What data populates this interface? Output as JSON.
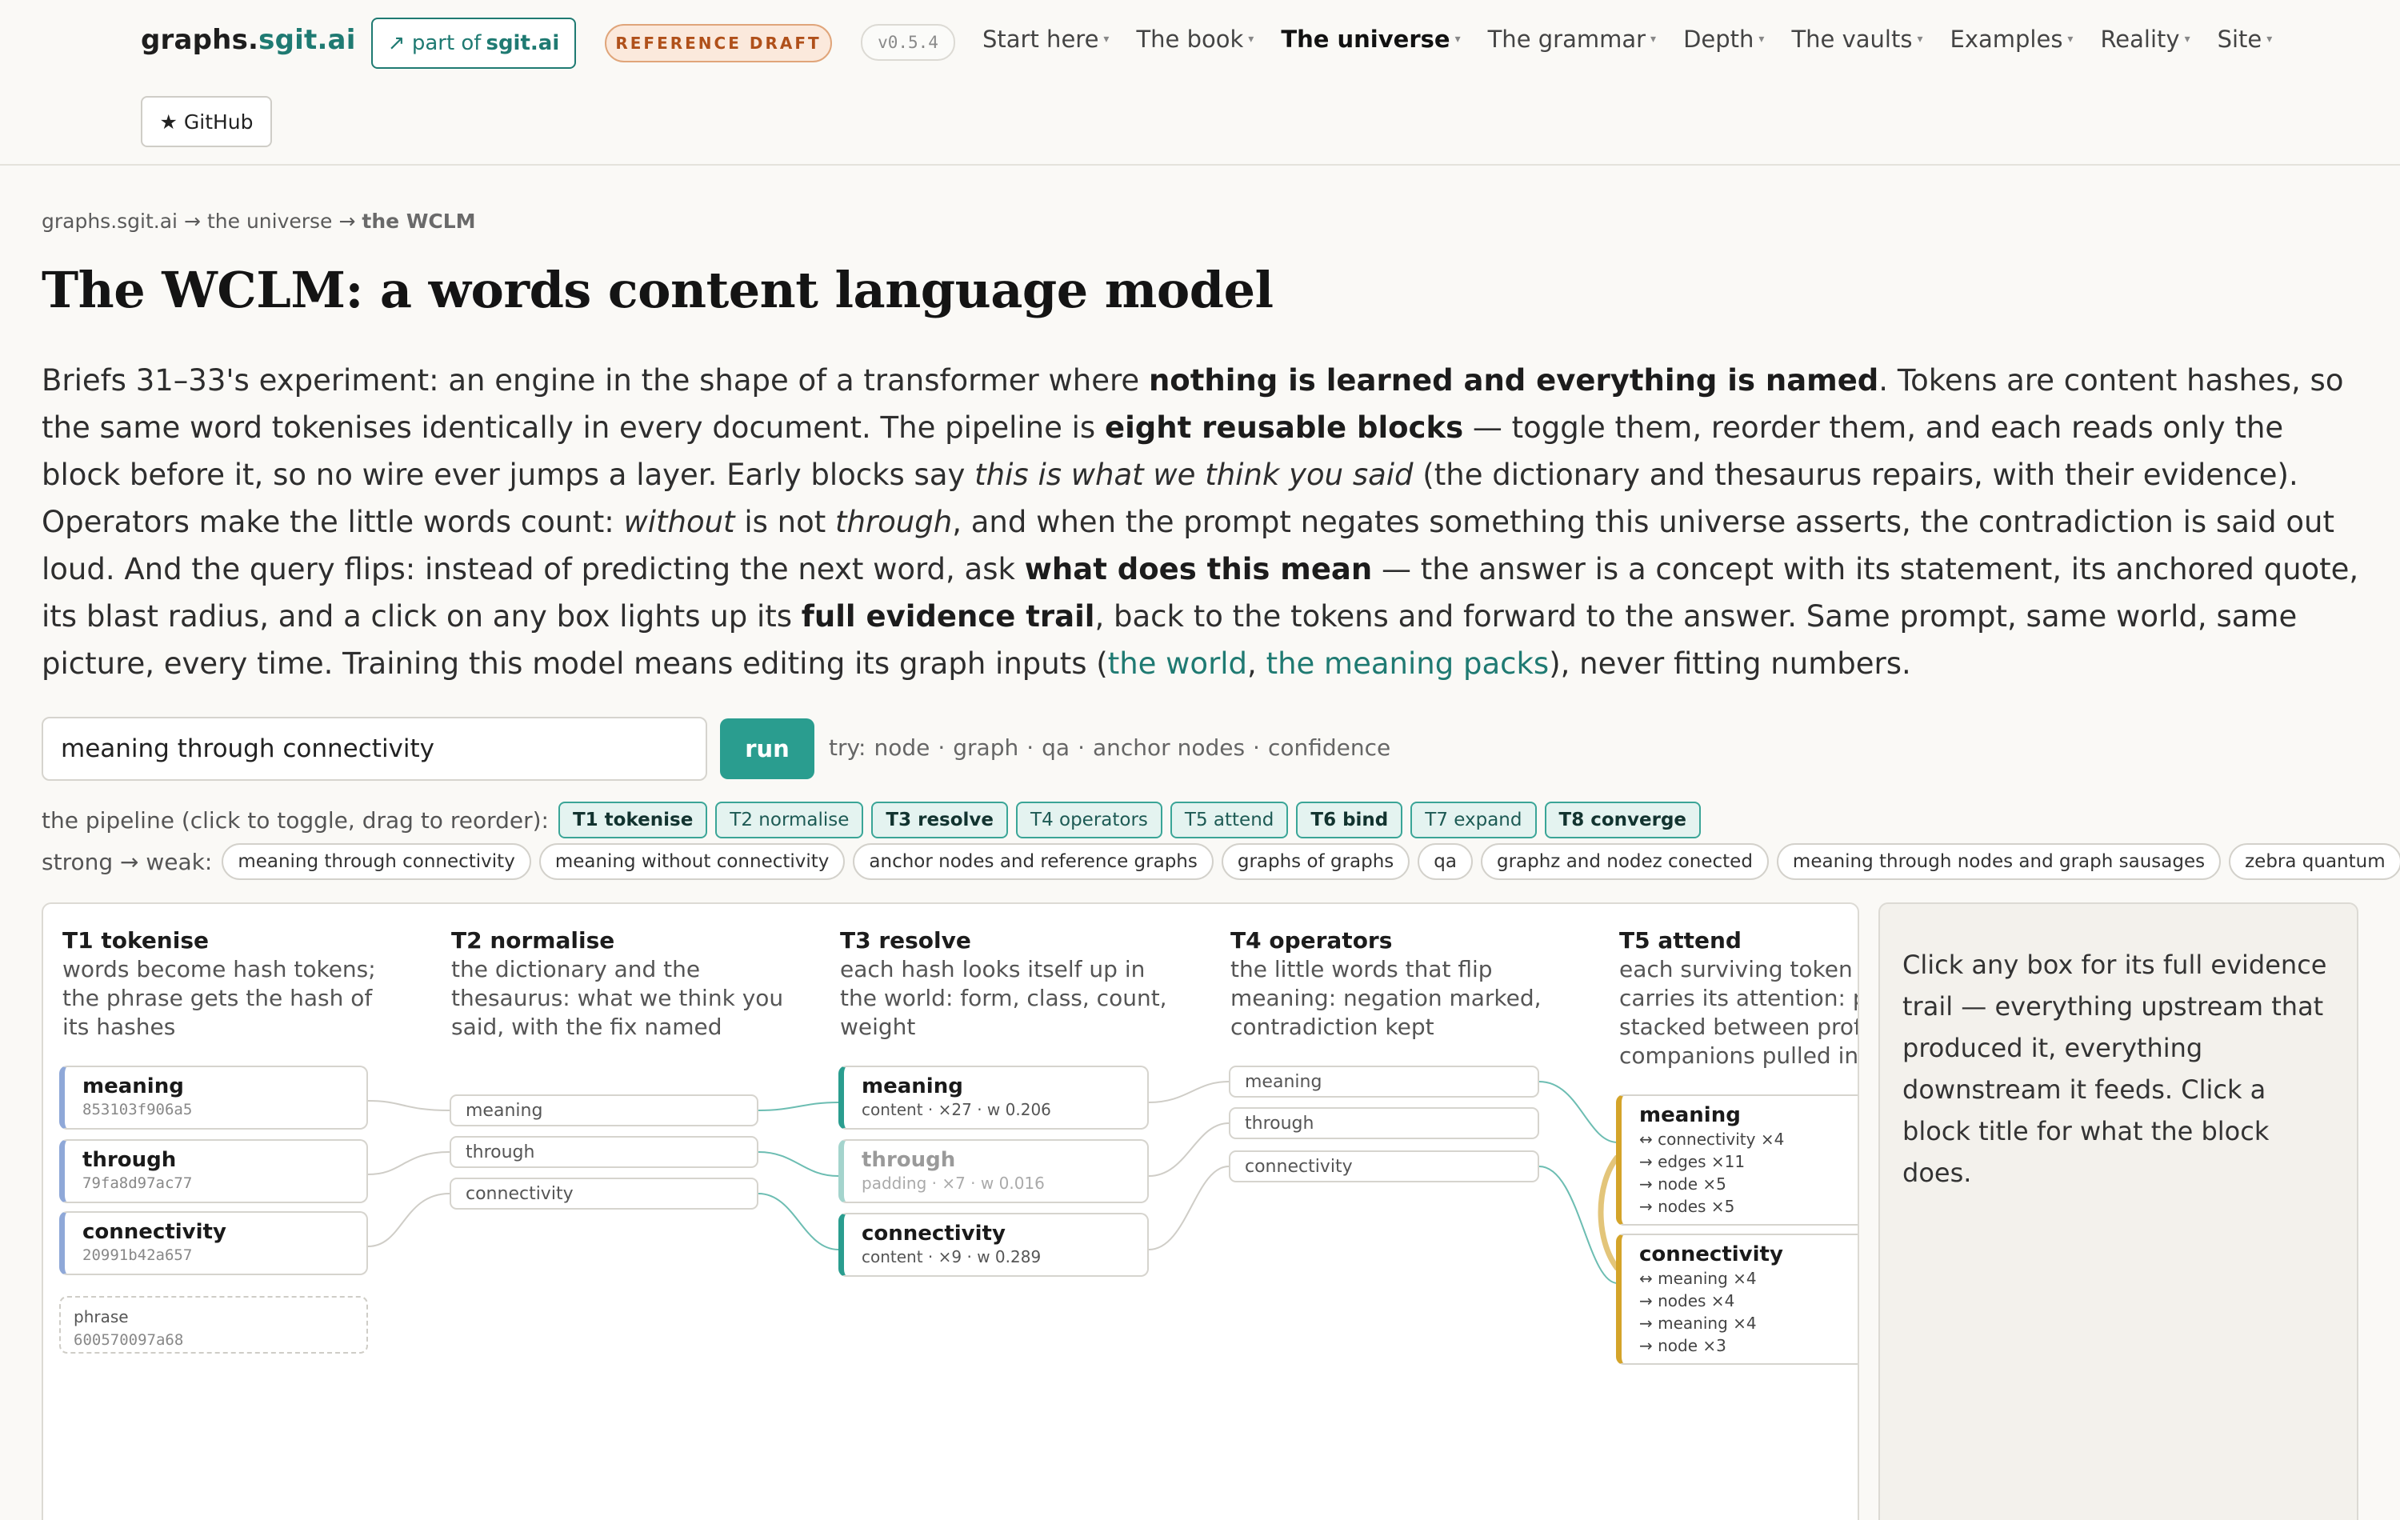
{
  "header": {
    "brand_main": "graphs.",
    "brand_accent": "sgit.ai",
    "part_of_prefix": "↗ part of",
    "part_of_site": "sgit.ai",
    "draft_badge": "REFERENCE DRAFT",
    "version": "v0.5.4",
    "nav": [
      {
        "label": "Start here",
        "active": false
      },
      {
        "label": "The book",
        "active": false
      },
      {
        "label": "The universe",
        "active": true
      },
      {
        "label": "The grammar",
        "active": false
      },
      {
        "label": "Depth",
        "active": false
      },
      {
        "label": "The vaults",
        "active": false
      },
      {
        "label": "Examples",
        "active": false
      },
      {
        "label": "Reality",
        "active": false
      },
      {
        "label": "Site",
        "active": false
      }
    ],
    "github_star": "★",
    "github_label": "GitHub"
  },
  "breadcrumb": {
    "root": "graphs.sgit.ai",
    "sep1": "→",
    "section": "the universe",
    "sep2": "→",
    "current": "the WCLM"
  },
  "page_title": "The WCLM: a words content language model",
  "intro": {
    "p1": "Briefs 31–33's experiment: an engine in the shape of a transformer where ",
    "b1": "nothing is learned and everything is named",
    "p2": ". Tokens are content hashes, so the same word tokenises identically in every document. The pipeline is ",
    "b2": "eight reusable blocks",
    "p3": " — toggle them, reorder them, and each reads only the block before it, so no wire ever jumps a layer. Early blocks say ",
    "i1": "this is what we think you said",
    "p4": " (the dictionary and thesaurus repairs, with their evidence). Operators make the little words count: ",
    "i2": "without",
    "p5": " is not ",
    "i3": "through",
    "p6": ", and when the prompt negates something this universe asserts, the contradiction is said out loud. And the query flips: instead of predicting the next word, ask ",
    "b3": "what does this mean",
    "p7": " — the answer is a concept with its statement, its anchored quote, its blast radius, and a click on any box lights up its ",
    "b4": "full evidence trail",
    "p8": ", back to the tokens and forward to the answer. Same prompt, same world, same picture, every time. Training this model means editing its graph inputs (",
    "link1": "the world",
    "p9": ", ",
    "link2": "the meaning packs",
    "p10": "), never fitting numbers."
  },
  "query": {
    "value": "meaning through connectivity",
    "run_label": "run",
    "try_prefix": "try:",
    "try_items": [
      "node",
      "graph",
      "qa",
      "anchor nodes",
      "confidence"
    ],
    "try_sep": "·"
  },
  "pipeline": {
    "label": "the pipeline (click to toggle, drag to reorder):",
    "blocks": [
      {
        "label": "T1 tokenise",
        "on": true
      },
      {
        "label": "T2 normalise",
        "on": false
      },
      {
        "label": "T3 resolve",
        "on": true
      },
      {
        "label": "T4 operators",
        "on": false
      },
      {
        "label": "T5 attend",
        "on": false
      },
      {
        "label": "T6 bind",
        "on": true
      },
      {
        "label": "T7 expand",
        "on": false
      },
      {
        "label": "T8 converge",
        "on": true
      }
    ]
  },
  "examples": {
    "label": "strong → weak:",
    "items": [
      "meaning through connectivity",
      "meaning without connectivity",
      "anchor nodes and reference graphs",
      "graphs of graphs",
      "qa",
      "graphz and nodez conected",
      "meaning through nodes and graph sausages",
      "zebra quantum"
    ]
  },
  "stage": {
    "t1": {
      "title": "T1 tokenise",
      "desc": "words become hash tokens; the phrase gets the hash of its hashes",
      "tokens": [
        {
          "word": "meaning",
          "hash": "853103f906a5"
        },
        {
          "word": "through",
          "hash": "79fa8d97ac77"
        },
        {
          "word": "connectivity",
          "hash": "20991b42a657"
        }
      ],
      "phrase": {
        "word": "phrase",
        "hash": "600570097a68"
      }
    },
    "t2": {
      "title": "T2 normalise",
      "desc": "the dictionary and the thesaurus: what we think you said, with the fix named",
      "words": [
        "meaning",
        "through",
        "connectivity"
      ]
    },
    "t3": {
      "title": "T3 resolve",
      "desc": "each hash looks itself up in the world: form, class, count, weight",
      "items": [
        {
          "word": "meaning",
          "meta": "content · ×27 · w 0.206",
          "dim": false
        },
        {
          "word": "through",
          "meta": "padding · ×7 · w 0.016",
          "dim": true
        },
        {
          "word": "connectivity",
          "meta": "content · ×9 · w 0.289",
          "dim": false
        }
      ]
    },
    "t4": {
      "title": "T4 operators",
      "desc": "the little words that flip meaning: negation marked, contradiction kept",
      "words": [
        "meaning",
        "through",
        "connectivity"
      ]
    },
    "t5": {
      "title": "T5 attend",
      "desc": "each surviving token carries its attention: p stacked between profi companions pulled in",
      "items": [
        {
          "word": "meaning",
          "links": [
            "↔ connectivity ×4",
            "→ edges ×11",
            "→ node ×5",
            "→ nodes ×5"
          ]
        },
        {
          "word": "connectivity",
          "links": [
            "↔ meaning ×4",
            "→ nodes ×4",
            "→ meaning ×4",
            "→ node ×3"
          ]
        }
      ]
    }
  },
  "detail_panel": {
    "text": "Click any box for its full evidence trail — everything upstream that produced it, everything downstream it feeds. Click a block title for what the block does."
  },
  "colors": {
    "accent": "#1f7a72",
    "run": "#2a9d8f",
    "token_bar": "#8fa8d8",
    "attend_bar": "#d4a42a"
  }
}
